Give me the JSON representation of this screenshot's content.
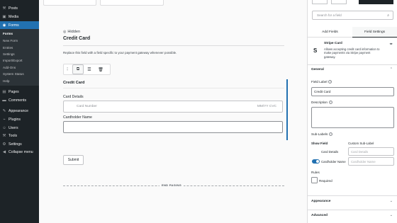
{
  "admin_menu": {
    "items": [
      {
        "label": "Posts",
        "icon": "pin-icon"
      },
      {
        "label": "Media",
        "icon": "media-icon"
      },
      {
        "label": "Forms",
        "icon": "forms-icon"
      }
    ],
    "forms_submenu": [
      "Forms",
      "New Form",
      "Entries",
      "Settings",
      "Import/Export",
      "Add-Ons",
      "System Status",
      "Help"
    ],
    "items_after": [
      {
        "label": "Pages",
        "icon": "page-icon"
      },
      {
        "label": "Comments",
        "icon": "comment-icon"
      },
      {
        "label": "Appearance",
        "icon": "brush-icon"
      },
      {
        "label": "Plugins",
        "icon": "plug-icon"
      },
      {
        "label": "Users",
        "icon": "user-icon"
      },
      {
        "label": "Tools",
        "icon": "wrench-icon"
      },
      {
        "label": "Settings",
        "icon": "settings-icon"
      },
      {
        "label": "Collapse menu",
        "icon": "collapse-icon"
      }
    ],
    "accent_color": "#2271b1"
  },
  "canvas": {
    "hidden_text": "Hidden",
    "page_title": "Credit Card",
    "description": "Replace this field with a field specific to your payment gateway whenever possible.",
    "field": {
      "title": "Credit Card",
      "card_details_label": "Card Details",
      "card_number_placeholder": "Card Number",
      "expiry_placeholder": "MM/YY CVC",
      "cardholder_label": "Cardholder Name"
    },
    "submit_label": "Submit",
    "end_paging_label": "END PAGING"
  },
  "panel": {
    "search_placeholder": "Search for a field",
    "tabs": [
      "Add Fields",
      "Field Settings"
    ],
    "active_tab": 1,
    "stripe": {
      "letter": "S",
      "name": "Stripe Card",
      "description": "Allows accepting credit card information to make payments via Stripe payment gateway.",
      "more": "◂▸"
    },
    "general_title": "General",
    "field_label_label": "Field Label",
    "field_label_value": "Credit Card",
    "description_label": "Description",
    "sublabels": {
      "title": "Sub-Labels",
      "show_field_header": "Show Field",
      "custom_header": "Custom Sub-Label",
      "rows": [
        {
          "label": "Card Details",
          "placeholder": "Card Details"
        },
        {
          "label": "Cardholder Name",
          "placeholder": "Cardholder Name"
        }
      ]
    },
    "rules_title": "Rules",
    "required_label": "Required",
    "appearance_title": "Appearance",
    "advanced_title": "Advanced"
  }
}
